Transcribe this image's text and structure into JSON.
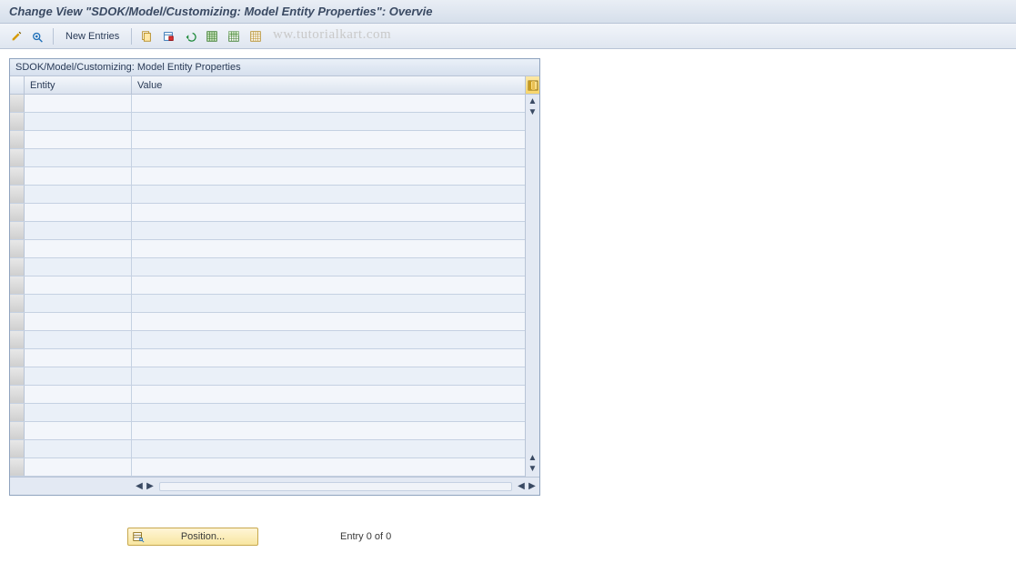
{
  "title": "Change View \"SDOK/Model/Customizing: Model Entity Properties\": Overvie",
  "toolbar": {
    "new_entries": "New Entries"
  },
  "watermark": "ww.tutorialkart.com",
  "panel": {
    "title": "SDOK/Model/Customizing: Model Entity Properties",
    "columns": {
      "entity": "Entity",
      "value": "Value"
    },
    "row_count": 21
  },
  "footer": {
    "position_label": "Position...",
    "entry_text": "Entry 0 of 0"
  }
}
